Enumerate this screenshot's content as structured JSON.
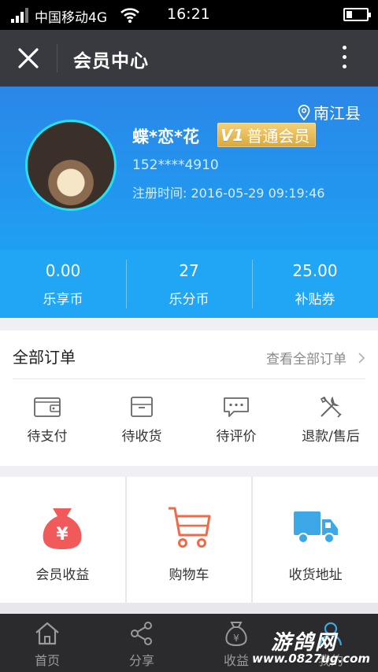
{
  "status_bar": {
    "carrier": "中国移动4G",
    "time": "16:21"
  },
  "nav": {
    "title": "会员中心"
  },
  "profile": {
    "location": "南江县",
    "username": "蝶*恋*花",
    "vip_level": "V1",
    "vip_label": "普通会员",
    "phone": "152****4910",
    "reg_label": "注册时间:",
    "reg_time": "2016-05-29 09:19:46"
  },
  "stats": [
    {
      "value": "0.00",
      "label": "乐享币"
    },
    {
      "value": "27",
      "label": "乐分币"
    },
    {
      "value": "25.00",
      "label": "补贴券"
    }
  ],
  "orders": {
    "title": "全部订单",
    "view_all": "查看全部订单",
    "items": [
      {
        "label": "待支付",
        "icon": "wallet-icon"
      },
      {
        "label": "待收货",
        "icon": "package-icon"
      },
      {
        "label": "待评价",
        "icon": "comment-icon"
      },
      {
        "label": "退款/售后",
        "icon": "tools-icon"
      }
    ]
  },
  "grid": [
    {
      "label": "会员收益",
      "icon": "money-bag-icon"
    },
    {
      "label": "购物车",
      "icon": "cart-icon"
    },
    {
      "label": "收货地址",
      "icon": "truck-icon"
    }
  ],
  "tabbar": [
    {
      "label": "首页",
      "icon": "home-icon"
    },
    {
      "label": "分享",
      "icon": "share-icon"
    },
    {
      "label": "收益",
      "icon": "yen-bag-icon"
    },
    {
      "label": "我的",
      "icon": "user-icon"
    }
  ],
  "watermark": {
    "brand": "游鸽网",
    "url": "www.0827ug.com"
  },
  "colors": {
    "header_blue": "#2a86e8",
    "stats_blue": "#20a6f5",
    "nav_dark": "#393a3f",
    "accent_red": "#f05a5a"
  }
}
